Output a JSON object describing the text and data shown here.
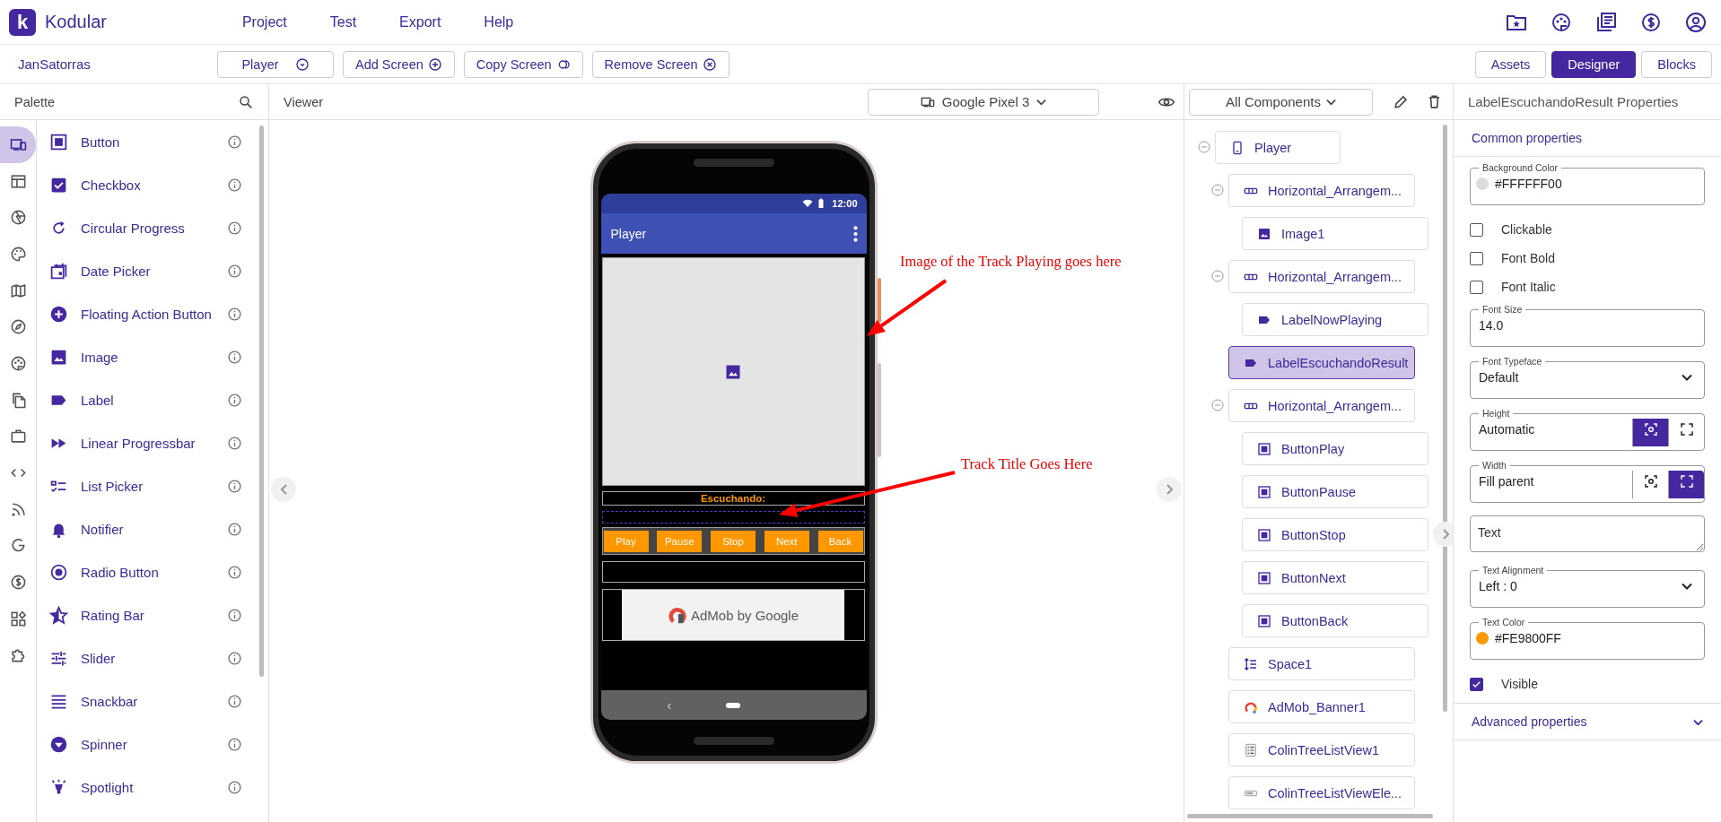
{
  "app": {
    "logo_mark": "k",
    "name": "Kodular"
  },
  "menu": [
    "Project",
    "Test",
    "Export",
    "Help"
  ],
  "project": {
    "name": "JanSatorras"
  },
  "screen_buttons": [
    {
      "label": "Player",
      "kind": "dropdown"
    },
    {
      "label": "Add Screen",
      "kind": "add"
    },
    {
      "label": "Copy Screen",
      "kind": "copy"
    },
    {
      "label": "Remove Screen",
      "kind": "remove"
    }
  ],
  "view_tabs": [
    {
      "label": "Assets",
      "selected": false
    },
    {
      "label": "Designer",
      "selected": true
    },
    {
      "label": "Blocks",
      "selected": false
    }
  ],
  "palette": {
    "title": "Palette",
    "categories": [
      {
        "selected": true
      },
      {
        "selected": false
      },
      {
        "selected": false
      },
      {
        "selected": false
      },
      {
        "selected": false
      },
      {
        "selected": false
      },
      {
        "selected": false
      },
      {
        "selected": false
      },
      {
        "selected": false
      },
      {
        "selected": false
      },
      {
        "selected": false
      },
      {
        "selected": false
      },
      {
        "selected": false
      },
      {
        "selected": false
      },
      {
        "selected": false
      }
    ],
    "items": [
      "Button",
      "Checkbox",
      "Circular Progress",
      "Date Picker",
      "Floating Action Button",
      "Image",
      "Label",
      "Linear Progressbar",
      "List Picker",
      "Notifier",
      "Radio Button",
      "Rating Bar",
      "Slider",
      "Snackbar",
      "Spinner",
      "Spotlight"
    ]
  },
  "viewer": {
    "title": "Viewer",
    "device": "Google Pixel 3",
    "phone": {
      "time": "12:00",
      "title": "Player",
      "label": "Escuchando:",
      "buttons": [
        "Play",
        "Pause",
        "Stop",
        "Next",
        "Back"
      ],
      "banner": "AdMob by Google",
      "nav_back": "‹"
    },
    "annotations": [
      {
        "text": "Image of the Track Playing goes here"
      },
      {
        "text": "Track Title Goes Here"
      }
    ]
  },
  "components": {
    "filter": "All Components",
    "tree": [
      {
        "name": "Player",
        "kind": "screen",
        "selected": false,
        "expanded": true,
        "children": [
          {
            "name": "Horizontal_Arrangem...",
            "kind": "arrangement",
            "selected": false,
            "expanded": true,
            "children": [
              {
                "name": "Image1",
                "kind": "image",
                "selected": false
              }
            ]
          },
          {
            "name": "Horizontal_Arrangem...",
            "kind": "arrangement",
            "selected": false,
            "expanded": true,
            "children": [
              {
                "name": "LabelNowPlaying",
                "kind": "label",
                "selected": false
              }
            ]
          },
          {
            "name": "LabelEscuchandoResult",
            "kind": "label",
            "selected": true
          },
          {
            "name": "Horizontal_Arrangem...",
            "kind": "arrangement",
            "selected": false,
            "expanded": true,
            "children": [
              {
                "name": "ButtonPlay",
                "kind": "button",
                "selected": false
              },
              {
                "name": "ButtonPause",
                "kind": "button",
                "selected": false
              },
              {
                "name": "ButtonStop",
                "kind": "button",
                "selected": false
              },
              {
                "name": "ButtonNext",
                "kind": "button",
                "selected": false
              },
              {
                "name": "ButtonBack",
                "kind": "button",
                "selected": false
              }
            ]
          },
          {
            "name": "Space1",
            "kind": "space",
            "selected": false
          },
          {
            "name": "AdMob_Banner1",
            "kind": "admob",
            "selected": false
          },
          {
            "name": "ColinTreeListView1",
            "kind": "listview",
            "selected": false
          },
          {
            "name": "ColinTreeListViewEle...",
            "kind": "listelement",
            "selected": false
          }
        ]
      }
    ]
  },
  "properties": {
    "title": "LabelEscuchandoResult Properties",
    "section": "Common properties",
    "fields": [
      {
        "kind": "color",
        "label": "Background Color",
        "value": "#FFFFFF00",
        "color": "#dcdcdc"
      },
      {
        "kind": "checkbox",
        "label": "Clickable",
        "checked": false
      },
      {
        "kind": "checkbox",
        "label": "Font Bold",
        "checked": false
      },
      {
        "kind": "checkbox",
        "label": "Font Italic",
        "checked": false
      },
      {
        "kind": "text",
        "label": "Font Size",
        "value": "14.0"
      },
      {
        "kind": "select",
        "label": "Font Typeface",
        "value": "Default"
      },
      {
        "kind": "size",
        "label": "Height",
        "value": "Automatic",
        "options": [
          {
            "selected": true
          },
          {
            "selected": false
          }
        ]
      },
      {
        "kind": "size",
        "label": "Width",
        "value": "Fill parent",
        "options": [
          {
            "selected": false
          },
          {
            "selected": true
          }
        ]
      },
      {
        "kind": "textarea",
        "placeholder": "Text"
      },
      {
        "kind": "select",
        "label": "Text Alignment",
        "value": "Left : 0"
      },
      {
        "kind": "color",
        "label": "Text Color",
        "value": "#FE9800FF",
        "color": "#fe9800"
      },
      {
        "kind": "checkbox",
        "label": "Visible",
        "checked": true
      }
    ],
    "advanced": {
      "label": "Advanced properties",
      "expanded": false
    }
  }
}
